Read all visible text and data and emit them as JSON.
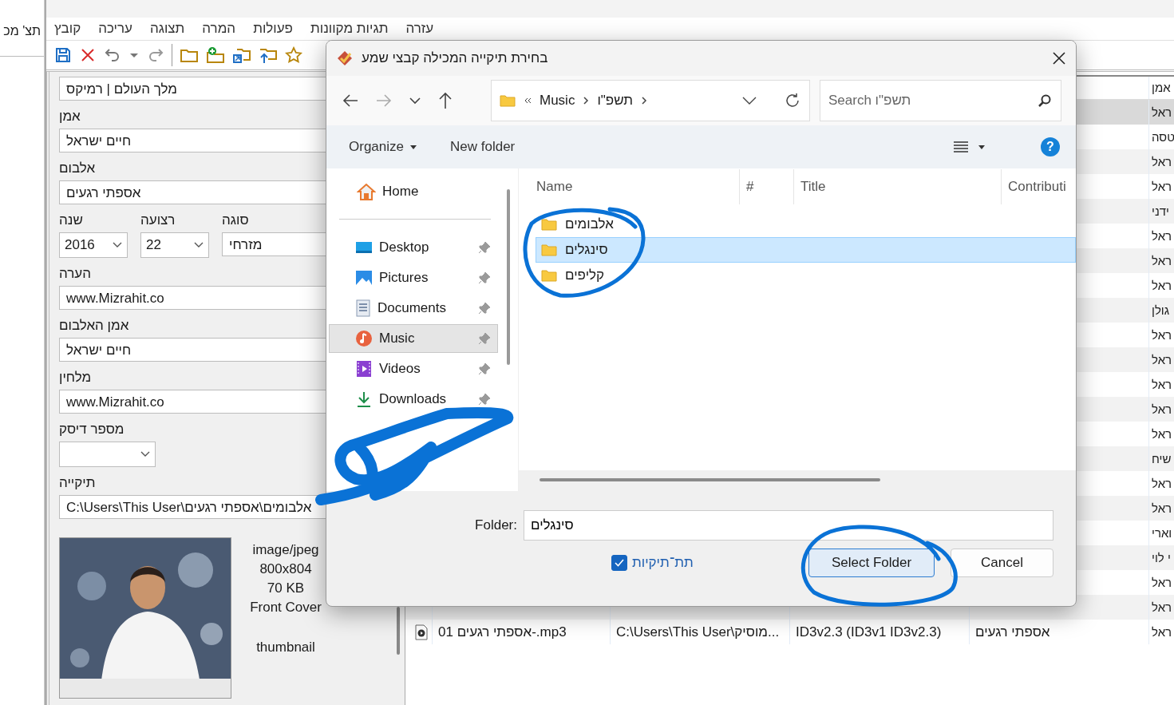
{
  "background_window": {
    "text": "תצ' מכ"
  },
  "menu": [
    "עזרה",
    "תגיות מקוונות",
    "פעולות",
    "המרה",
    "תצוגה",
    "עריכה",
    "קובץ"
  ],
  "toolbar": [
    {
      "kind": "save"
    },
    {
      "kind": "remove"
    },
    {
      "kind": "undo"
    },
    {
      "kind": "caret"
    },
    {
      "kind": "redo"
    },
    {
      "kind": "separator"
    },
    {
      "kind": "folder"
    },
    {
      "kind": "folder-add"
    },
    {
      "kind": "folder-import"
    },
    {
      "kind": "folder-up"
    },
    {
      "kind": "star"
    }
  ],
  "tag_panel": {
    "fields": [
      {
        "kind": "text",
        "value": "מלך העולם | רמיקס"
      },
      {
        "kind": "text",
        "label": "אמן",
        "value": "חיים ישראל"
      },
      {
        "kind": "text",
        "label": "אלבום",
        "value": "אספתי רגעים"
      },
      {
        "kind": "group",
        "items": [
          {
            "kind": "text",
            "label": "סוגה",
            "value": "מזרחי"
          },
          {
            "kind": "combo",
            "label": "רצועה",
            "value": "22"
          },
          {
            "kind": "combo",
            "label": "שנה",
            "value": "2016"
          }
        ]
      },
      {
        "kind": "text",
        "label": "הערה",
        "value": "www.Mizrahit.co"
      },
      {
        "kind": "text",
        "label": "אמן האלבום",
        "value": "חיים ישראל"
      },
      {
        "kind": "text",
        "label": "מלחין",
        "value": "www.Mizrahit.co"
      },
      {
        "kind": "combo",
        "label": "מספר דיסק"
      },
      {
        "kind": "text",
        "label": "תיקייה",
        "value": "C:\\Users\\This User\\אלבומים\\אספתי רגעים"
      }
    ],
    "cover": {
      "details": [
        "image/jpeg",
        "800x804",
        "70 KB",
        "Front Cover"
      ],
      "caption": "thumbnail"
    }
  },
  "file_list": {
    "header": "אמן",
    "rows": [
      {
        "artist": "ראל",
        "selected": true
      },
      {
        "artist": "טסה",
        "selected": false
      },
      {
        "artist": "ראל",
        "selected": false
      },
      {
        "artist": "ראל",
        "selected": false
      },
      {
        "artist": "ידני",
        "selected": false
      },
      {
        "artist": "ראל",
        "selected": false
      },
      {
        "artist": "ראל",
        "selected": false
      },
      {
        "artist": "ראל",
        "selected": false
      },
      {
        "artist": "גולן",
        "selected": false
      },
      {
        "artist": "ראל",
        "selected": false
      },
      {
        "artist": "ראל",
        "selected": false
      },
      {
        "artist": "ראל",
        "selected": false
      },
      {
        "artist": "ראל",
        "selected": false
      },
      {
        "artist": "ראל",
        "selected": false
      },
      {
        "artist": "שיח",
        "selected": false
      },
      {
        "artist": "ראל",
        "selected": false
      },
      {
        "artist": "ראל",
        "selected": false
      },
      {
        "artist": "וארי",
        "selected": false
      },
      {
        "artist": "י לוי",
        "selected": false
      },
      {
        "artist": "ראל",
        "selected": false
      },
      {
        "artist": "ראל",
        "selected": false
      },
      {
        "artist": "ראל",
        "selected": false,
        "filename": "01 אספתי רגעים-.mp3",
        "path": "C:\\Users\\This User\\מוסיק...",
        "tag": "ID3v2.3 (ID3v1 ID3v2.3)",
        "album": "אספתי רגעים"
      }
    ]
  },
  "dialog": {
    "title": "בחירת תיקייה המכילה קבצי שמע",
    "breadcrumbs": {
      "parent": "Music",
      "current": "תשפ\"ו"
    },
    "search_placeholder": "Search תשפ\"ו",
    "commands": {
      "organize": "Organize",
      "new_folder": "New folder"
    },
    "help": "?",
    "home": "Home",
    "nav": [
      {
        "kind": "desktop",
        "label": "Desktop",
        "pinned": true,
        "selected": false
      },
      {
        "kind": "pictures",
        "label": "Pictures",
        "pinned": true,
        "selected": false
      },
      {
        "kind": "documents",
        "label": "Documents",
        "pinned": true,
        "selected": false
      },
      {
        "kind": "music",
        "label": "Music",
        "pinned": true,
        "selected": true
      },
      {
        "kind": "videos",
        "label": "Videos",
        "pinned": true,
        "selected": false
      },
      {
        "kind": "downloads",
        "label": "Downloads",
        "pinned": true,
        "selected": false
      }
    ],
    "columns": {
      "name": "Name",
      "number": "#",
      "title": "Title",
      "column_4": "Contributi"
    },
    "folders": [
      {
        "name": "אלבומים",
        "selected": false
      },
      {
        "name": "סינגלים",
        "selected": true
      },
      {
        "name": "קליפים",
        "selected": false
      }
    ],
    "folder_label": "Folder:",
    "folder_value": "סינגלים",
    "subfolders": {
      "label": "תת־תיקיות",
      "checked": true
    },
    "select_button": "Select Folder",
    "cancel_button": "Cancel"
  }
}
